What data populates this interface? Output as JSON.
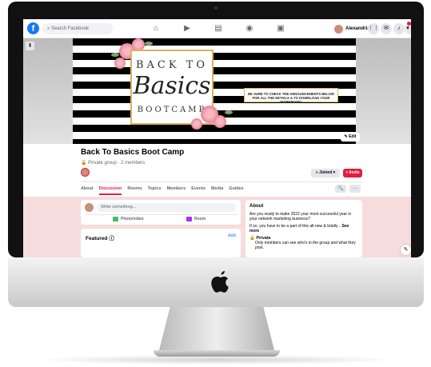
{
  "topbar": {
    "logo": "f",
    "search_placeholder": "Search Facebook",
    "nav_icons": [
      "home-icon",
      "watch-icon",
      "marketplace-icon",
      "groups-icon",
      "gaming-icon"
    ],
    "profile_name": "Alexandria",
    "right_icons": [
      "menu-grid-icon",
      "messenger-icon",
      "bell-icon",
      "account-icon"
    ]
  },
  "cover": {
    "line1": "BACK TO",
    "line2": "Basics",
    "line3": "BOOTCAMP",
    "notice": "BE SURE TO CHECK THE ANNOUNCEMENTS BELOW FOR ALL THE DETAILS & TO DOWNLOAD YOUR WORKBOOK!",
    "edit_label": "✎ Edit"
  },
  "group": {
    "title": "Back To Basics Boot Camp",
    "subtitle": "🔒 Private group · 2 members",
    "joined_label": "≡ Joined ▾",
    "invite_label": "+ Invite",
    "tabs": [
      "About",
      "Discussion",
      "Rooms",
      "Topics",
      "Members",
      "Events",
      "Media",
      "Guides"
    ],
    "active_tab": "Discussion",
    "search_btn": "🔍",
    "more_btn": "···"
  },
  "composer": {
    "placeholder": "Write something...",
    "photo_label": "Photo/video",
    "room_label": "Room"
  },
  "featured": {
    "title": "Featured ⓘ",
    "add_label": "Add"
  },
  "about": {
    "title": "About",
    "text1": "Are you ready to make 2022 your most successful year in your network marketing business?",
    "text2": "If so, you have to be a part of this all-new & totally...",
    "see_more": "See more",
    "private_title": "🔒 Private",
    "private_text": "Only members can see who's in the group and what they post."
  },
  "colors": {
    "facebook_blue": "#1877f2",
    "accent_red": "#e41e3f",
    "body_pink": "#f6dcdc",
    "frame_gold": "#d6b45a"
  }
}
